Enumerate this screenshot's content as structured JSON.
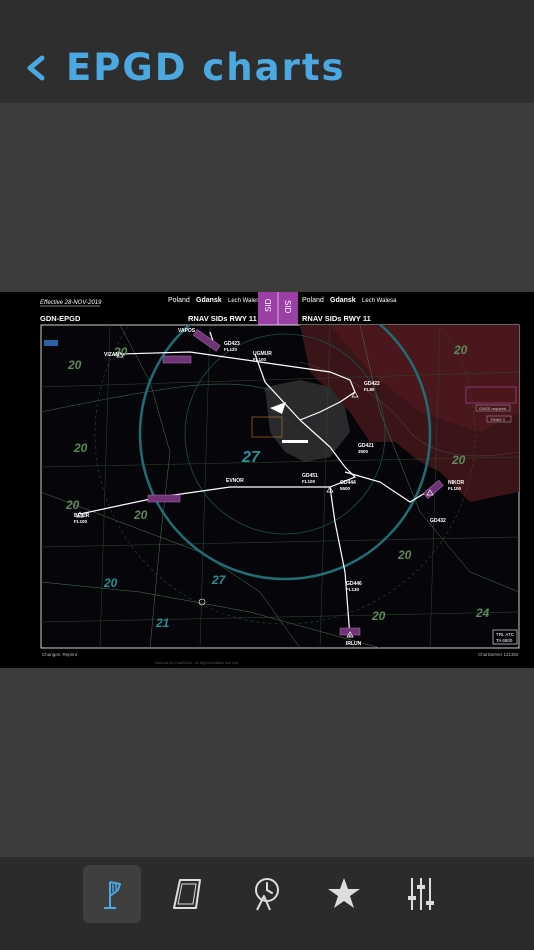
{
  "header": {
    "title": "EPGD charts",
    "back_icon": "chevron-left-icon"
  },
  "chart": {
    "effective": "Effective 28-NOV-2019",
    "country_left": "Poland",
    "city_left": "Gdansk",
    "airport_left": "Lech Walesa",
    "country_right": "Poland",
    "city_right": "Gdansk",
    "airport_right": "Lech Walesa",
    "sid_badge": "SID",
    "icao": "GDN-EPGD",
    "procedure_left": "RNAV SIDs RWY 11",
    "procedure_right": "RNAV SIDs RWY 11",
    "gnss": "GNSS required",
    "rnav": "RNAV 1",
    "footer_left": "Changes: Reprint",
    "footer_right": "ChartServer 121302",
    "watermark": "NavData by ChartCloud - for flight simulation use only",
    "trans": "TRL ATC",
    "ta": "TA 6500",
    "waypoints": [
      "VIZAN",
      "GD423",
      "UGMUR",
      "GD422",
      "GD421",
      "GD451",
      "EVNOR",
      "GD444",
      "BEXIR",
      "NIKOR",
      "GD432",
      "GD446",
      "IRLUN",
      "VAPOS"
    ],
    "levels": [
      "FL100",
      "FL120",
      "FL100",
      "FL80",
      "3500",
      "FL100",
      "5500",
      "FL100",
      "FL100",
      "FL130"
    ],
    "msa": [
      "20",
      "20",
      "20",
      "20",
      "20",
      "20",
      "20",
      "20",
      "20",
      "27",
      "27",
      "21",
      "24",
      "20"
    ]
  },
  "tabs": [
    {
      "name": "airport-tab",
      "icon": "windsock-icon",
      "active": true
    },
    {
      "name": "charts-tab",
      "icon": "chart-page-icon",
      "active": false
    },
    {
      "name": "recent-tab",
      "icon": "clock-history-icon",
      "active": false
    },
    {
      "name": "favorites-tab",
      "icon": "star-icon",
      "active": false
    },
    {
      "name": "settings-tab",
      "icon": "sliders-icon",
      "active": false
    }
  ],
  "colors": {
    "accent": "#4ba8e0",
    "header_bg": "#2e2e2e",
    "body_bg": "#3c3c3c",
    "tabbar_bg": "#2b2b2b",
    "sid_magenta": "#9b3fa6"
  }
}
